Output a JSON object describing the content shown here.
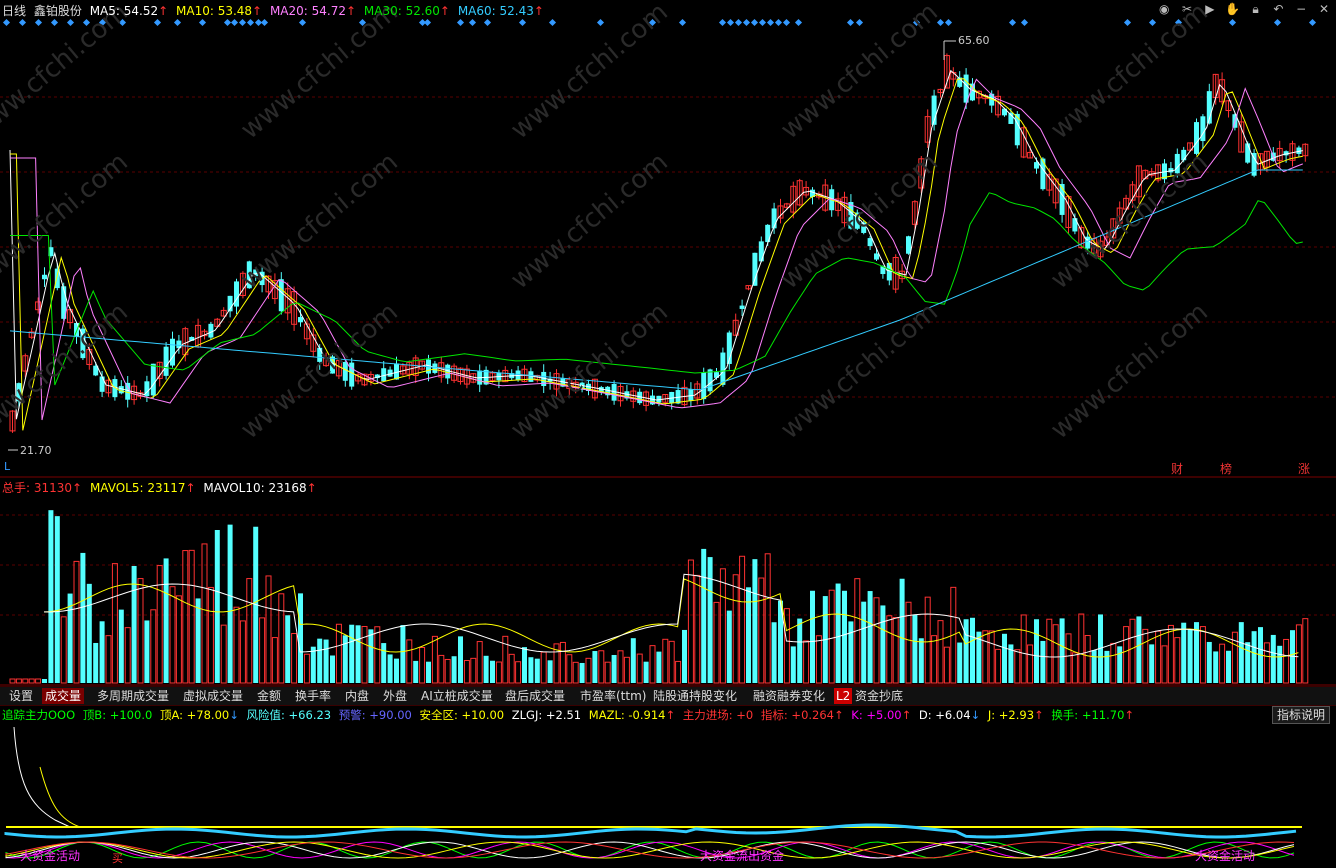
{
  "price_header": {
    "period": "日线",
    "stock_name": "鑫铂股份",
    "ma5": "MA5: 54.52",
    "ma10": "MA10: 53.48",
    "ma20": "MA20: 54.72",
    "ma30": "MA30: 52.60",
    "ma60": "MA60: 52.43"
  },
  "price_high_label": "65.60",
  "price_low_label": "21.70",
  "left_mark": "L",
  "badges": {
    "cai": "财",
    "bang": "榜",
    "zhang": "涨"
  },
  "vol_header": {
    "total": "总手: 31130",
    "mavol5": "MAVOL5: 23117",
    "mavol10": "MAVOL10: 23168"
  },
  "tabs": [
    {
      "label": "设置"
    },
    {
      "label": "成交量"
    },
    {
      "label": "多周期成交量"
    },
    {
      "label": "虚拟成交量"
    },
    {
      "label": "金额"
    },
    {
      "label": "换手率"
    },
    {
      "label": "内盘"
    },
    {
      "label": "外盘"
    },
    {
      "label": "AI立桩成交量"
    },
    {
      "label": "盘后成交量"
    },
    {
      "label": "市盈率(ttm)"
    },
    {
      "label": "陆股通持股变化"
    },
    {
      "label": "融资融券变化"
    },
    {
      "label": "L2"
    },
    {
      "label": "资金抄底"
    }
  ],
  "ind_header": {
    "name": "追踪主力OOO",
    "dingB": "顶B: +100.0",
    "dingA": "顶A: +78.00",
    "fengxian": "风险值: +66.23",
    "yujing": "预警: +90.00",
    "anquan": "安全区: +10.00",
    "zlgj": "ZLGJ: +2.51",
    "mazl": "MAZL: -0.914",
    "zhuli": "主力进场: +0",
    "zhibiao": "指标: +0.264",
    "k": "K: +5.00",
    "d": "D: +6.04",
    "j": "J: +2.93",
    "huanshou": "换手: +11.70"
  },
  "ind_button": "指标说明",
  "ind_overlay": {
    "a": "大资金活动",
    "b": "大资金流出资金",
    "c": "大资金活动",
    "buy": "买"
  },
  "colors": {
    "up": "#ff3232",
    "down": "#54ffff",
    "ma5": "#ffffff",
    "ma10": "#ffff00",
    "ma20": "#ff80ff",
    "ma30": "#00e600",
    "ma60": "#33ccff",
    "diamond": "#3399ff"
  },
  "toolbar_icons": [
    "eye-icon",
    "scissors-icon",
    "play-icon",
    "hand-icon",
    "lock-icon",
    "back-icon",
    "minus-icon",
    "close-icon"
  ],
  "watermark": "www.cfchi.com"
}
